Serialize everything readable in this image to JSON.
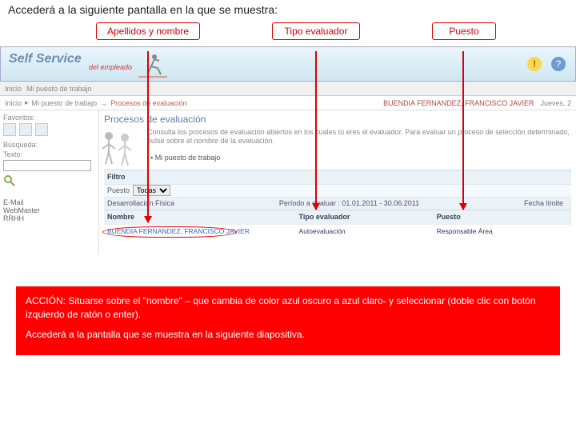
{
  "title": "Accederá a la siguiente pantalla en la que se muestra:",
  "labels": {
    "apellidos": "Apellidos y nombre",
    "tipo": "Tipo evaluador",
    "puesto": "Puesto"
  },
  "header": {
    "logo": "Self Service",
    "sublogo": "del empleado"
  },
  "crumb1": {
    "inicio": "Inicio",
    "puesto": "Mi puesto de trabajo"
  },
  "crumb2": {
    "inicio": "Inicio",
    "puesto": "Mi puesto de trabajo",
    "procesos": "Procesos de evaluación",
    "user": "BUENDIA FERNANDEZ, FRANCISCO JAVIER",
    "date": "Jueves, 2"
  },
  "sidebar": {
    "favoritos": "Favoritos:",
    "busqueda": "Búsqueda:",
    "texto_label": "Texto:",
    "links": {
      "email": "E-Mail",
      "webmaster": "WebMaster",
      "rrhh": "RRHH"
    }
  },
  "content": {
    "heading": "Procesos de evaluación",
    "desc": "Consulta los procesos de evaluación abiertos en los cuales tú eres el evaluador. Para evaluar un proceso de selección determinado, pulse sobre el nombre de la evaluación.",
    "bullet": "Mi puesto de trabajo",
    "filter_label": "Filtro",
    "puesto_label": "Puesto",
    "puesto_value": "Todas",
    "grad_label": "Desarrollación Física",
    "periodo": "Período a evaluar : 01.01.2011 - 30.06.2011",
    "fecha_limite": "Fecha límite",
    "columns": {
      "nombre": "Nombre",
      "tipo": "Tipo evaluador",
      "puesto": "Puesto"
    },
    "row": {
      "nombre": "BUENDIA FERNANDEZ, FRANCISCO JAVIER",
      "tipo": "Autoevaluación",
      "puesto": "Responsable Área"
    }
  },
  "action": {
    "line1": "ACCIÓN: Situarse sobre el \"nombre\" – que cambia de color azul oscuro a azul claro- y seleccionar (doble clic con botón izquierdo de ratón o enter).",
    "line2": "Accederá a la pantalla que se muestra en la siguiente diapositiva."
  }
}
